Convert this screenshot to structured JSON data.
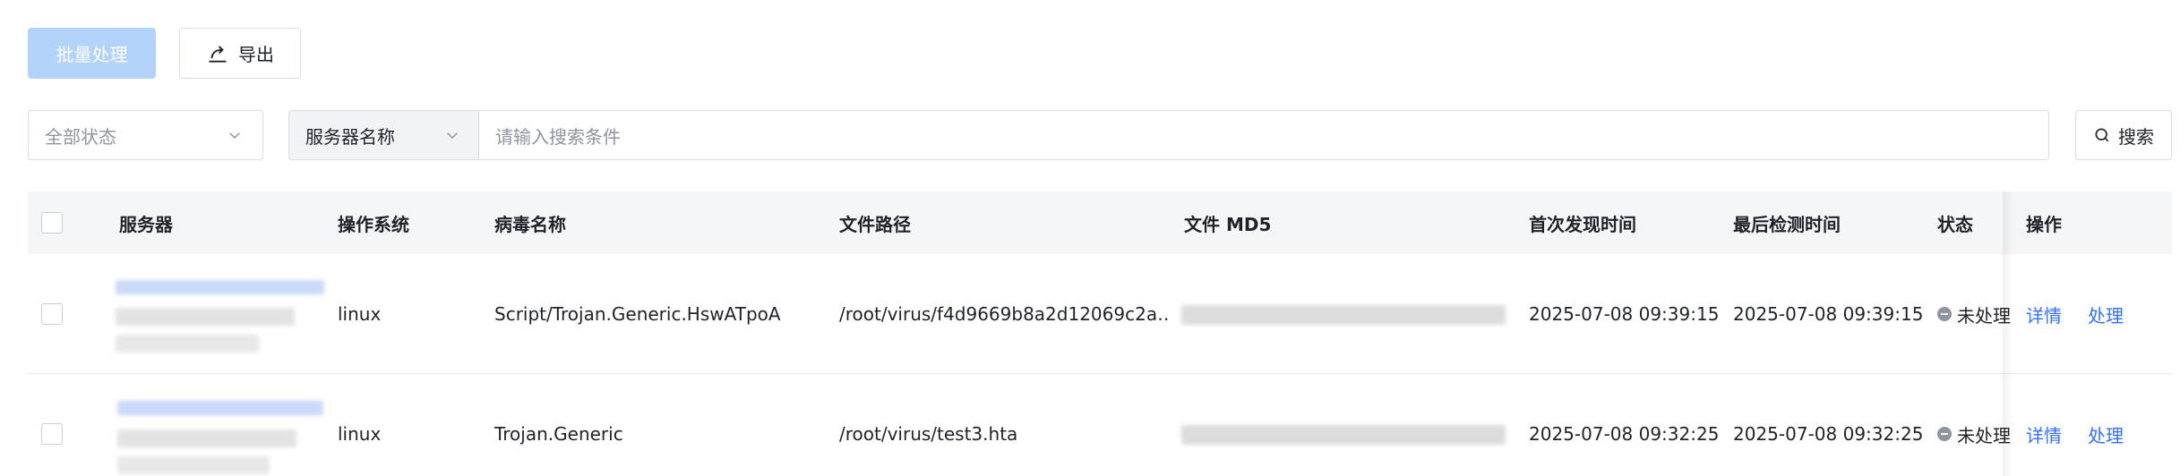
{
  "toolbar": {
    "batch_label": "批量处理",
    "export_label": "导出",
    "export_icon": "share-export-icon"
  },
  "filters": {
    "status_value": "全部状态",
    "field_value": "服务器名称",
    "search_placeholder": "请输入搜索条件",
    "search_label": "搜索"
  },
  "table": {
    "headers": {
      "server": "服务器",
      "os": "操作系统",
      "virus": "病毒名称",
      "path": "文件路径",
      "md5": "文件 MD5",
      "first_seen": "首次发现时间",
      "last_check": "最后检测时间",
      "status": "状态",
      "ops": "操作"
    },
    "rows": [
      {
        "os": "linux",
        "virus": "Script/Trojan.Generic.HswATpoA",
        "path": "/root/virus/f4d9669b8a2d12069c2a…",
        "first_seen": "2025-07-08 09:39:15",
        "last_check": "2025-07-08 09:39:15",
        "status": "未处理",
        "detail": "详情",
        "handle": "处理"
      },
      {
        "os": "linux",
        "virus": "Trojan.Generic",
        "path": "/root/virus/test3.hta",
        "first_seen": "2025-07-08 09:32:25",
        "last_check": "2025-07-08 09:32:25",
        "status": "未处理",
        "detail": "详情",
        "handle": "处理"
      }
    ]
  },
  "colors": {
    "primary_disabled": "#b3d3fb",
    "link": "#3370ff",
    "header_bg": "#f5f6f7",
    "border": "#d9dde3"
  }
}
